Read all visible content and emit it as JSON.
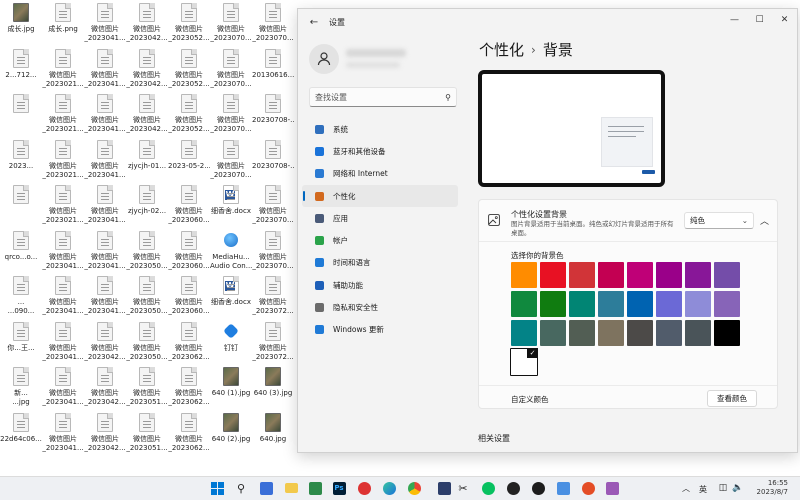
{
  "desktop": {
    "icons": [
      {
        "label": "成长.jpg",
        "label2": "",
        "kind": "photo"
      },
      {
        "label": "成长.png",
        "label2": "",
        "kind": "file"
      },
      {
        "label": "微信图片",
        "label2": "_2023041...",
        "kind": "file"
      },
      {
        "label": "微信图片",
        "label2": "_2023042...",
        "kind": "file"
      },
      {
        "label": "微信图片",
        "label2": "_2023052...",
        "kind": "file"
      },
      {
        "label": "微信图片",
        "label2": "_2023070...",
        "kind": "file"
      },
      {
        "label": "微信图片",
        "label2": "_2023070...",
        "kind": "file"
      },
      {
        "label": "2...712...",
        "label2": "",
        "kind": "file"
      },
      {
        "label": "微信图片",
        "label2": "_2023021...",
        "kind": "file"
      },
      {
        "label": "微信图片",
        "label2": "_2023041...",
        "kind": "file"
      },
      {
        "label": "微信图片",
        "label2": "_2023042...",
        "kind": "file"
      },
      {
        "label": "微信图片",
        "label2": "_2023052...",
        "kind": "file"
      },
      {
        "label": "微信图片",
        "label2": "_2023070...",
        "kind": "file"
      },
      {
        "label": "20130616...",
        "label2": "",
        "kind": "file"
      },
      {
        "label": "",
        "label2": "",
        "kind": "file"
      },
      {
        "label": "微信图片",
        "label2": "_2023021...",
        "kind": "file"
      },
      {
        "label": "微信图片",
        "label2": "_2023041...",
        "kind": "file"
      },
      {
        "label": "微信图片",
        "label2": "_2023042...",
        "kind": "file"
      },
      {
        "label": "微信图片",
        "label2": "_2023052...",
        "kind": "file"
      },
      {
        "label": "微信图片",
        "label2": "_2023070...",
        "kind": "file"
      },
      {
        "label": "20230708-...",
        "label2": "",
        "kind": "file"
      },
      {
        "label": "2023...",
        "label2": "",
        "kind": "file"
      },
      {
        "label": "微信图片",
        "label2": "_2023021...",
        "kind": "file"
      },
      {
        "label": "微信图片",
        "label2": "_2023041...",
        "kind": "file"
      },
      {
        "label": "zjycjh-01...",
        "label2": "",
        "kind": "file"
      },
      {
        "label": "2023-05-2...",
        "label2": "",
        "kind": "file"
      },
      {
        "label": "微信图片",
        "label2": "_2023070...",
        "kind": "file"
      },
      {
        "label": "20230708-...",
        "label2": "",
        "kind": "file"
      },
      {
        "label": "",
        "label2": "",
        "kind": "file"
      },
      {
        "label": "微信图片",
        "label2": "_2023021...",
        "kind": "file"
      },
      {
        "label": "微信图片",
        "label2": "_2023041...",
        "kind": "file"
      },
      {
        "label": "zjycjh-02...",
        "label2": "",
        "kind": "file"
      },
      {
        "label": "微信图片",
        "label2": "_2023060...",
        "kind": "file"
      },
      {
        "label": "细香舍.docx",
        "label2": "",
        "kind": "doc"
      },
      {
        "label": "微信图片",
        "label2": "_2023070...",
        "kind": "file"
      },
      {
        "label": "qrco...o...",
        "label2": "",
        "kind": "file"
      },
      {
        "label": "微信图片",
        "label2": "_2023041...",
        "kind": "file"
      },
      {
        "label": "微信图片",
        "label2": "_2023041...",
        "kind": "file"
      },
      {
        "label": "微信图片",
        "label2": "_2023050...",
        "kind": "file"
      },
      {
        "label": "微信图片",
        "label2": "_2023060...",
        "kind": "file"
      },
      {
        "label": "MediaHu...",
        "label2": "Audio Con...",
        "kind": "globe"
      },
      {
        "label": "微信图片",
        "label2": "_2023070...",
        "kind": "file"
      },
      {
        "label": "...",
        "label2": "...090...",
        "kind": "file"
      },
      {
        "label": "微信图片",
        "label2": "_2023041...",
        "kind": "file"
      },
      {
        "label": "微信图片",
        "label2": "_2023041...",
        "kind": "file"
      },
      {
        "label": "微信图片",
        "label2": "_2023050...",
        "kind": "file"
      },
      {
        "label": "微信图片",
        "label2": "_2023060...",
        "kind": "file"
      },
      {
        "label": "细香舍.docx",
        "label2": "",
        "kind": "doc"
      },
      {
        "label": "微信图片",
        "label2": "_2023072...",
        "kind": "file"
      },
      {
        "label": "你...王...",
        "label2": "",
        "kind": "file"
      },
      {
        "label": "微信图片",
        "label2": "_2023041...",
        "kind": "file"
      },
      {
        "label": "微信图片",
        "label2": "_2023042...",
        "kind": "file"
      },
      {
        "label": "微信图片",
        "label2": "_2023050...",
        "kind": "file"
      },
      {
        "label": "微信图片",
        "label2": "_2023062...",
        "kind": "file"
      },
      {
        "label": "钉钉",
        "label2": "",
        "kind": "blue"
      },
      {
        "label": "微信图片",
        "label2": "_2023072...",
        "kind": "file"
      },
      {
        "label": "新...",
        "label2": "...jpg",
        "kind": "file"
      },
      {
        "label": "微信图片",
        "label2": "_2023041...",
        "kind": "file"
      },
      {
        "label": "微信图片",
        "label2": "_2023042...",
        "kind": "file"
      },
      {
        "label": "微信图片",
        "label2": "_2023051...",
        "kind": "file"
      },
      {
        "label": "微信图片",
        "label2": "_2023062...",
        "kind": "file"
      },
      {
        "label": "640 (1).jpg",
        "label2": "",
        "kind": "photo"
      },
      {
        "label": "640 (3).jpg",
        "label2": "",
        "kind": "photo"
      },
      {
        "label": "22d64c06...",
        "label2": "",
        "kind": "file"
      },
      {
        "label": "微信图片",
        "label2": "_2023041...",
        "kind": "file"
      },
      {
        "label": "微信图片",
        "label2": "_2023042...",
        "kind": "file"
      },
      {
        "label": "微信图片",
        "label2": "_2023051...",
        "kind": "file"
      },
      {
        "label": "微信图片",
        "label2": "_2023062...",
        "kind": "file"
      },
      {
        "label": "640 (2).jpg",
        "label2": "",
        "kind": "photo"
      },
      {
        "label": "640.jpg",
        "label2": "",
        "kind": "photo"
      }
    ]
  },
  "window": {
    "title": "设置",
    "search_placeholder": "查找设置",
    "nav": [
      {
        "label": "系统",
        "icon": "monitor-icon",
        "color": "#2f6fbd",
        "active": false
      },
      {
        "label": "蓝牙和其他设备",
        "icon": "bluetooth-icon",
        "color": "#1a73d9",
        "active": false
      },
      {
        "label": "网络和 Internet",
        "icon": "wifi-icon",
        "color": "#2a7ad2",
        "active": false
      },
      {
        "label": "个性化",
        "icon": "brush-icon",
        "color": "#d2691e",
        "active": true
      },
      {
        "label": "应用",
        "icon": "apps-icon",
        "color": "#4a5a78",
        "active": false
      },
      {
        "label": "帐户",
        "icon": "account-icon",
        "color": "#2aa34a",
        "active": false
      },
      {
        "label": "时间和语言",
        "icon": "globe-icon",
        "color": "#1f7ad6",
        "active": false
      },
      {
        "label": "辅助功能",
        "icon": "accessibility-icon",
        "color": "#1d5fb8",
        "active": false
      },
      {
        "label": "隐私和安全性",
        "icon": "shield-icon",
        "color": "#6b6b6b",
        "active": false
      },
      {
        "label": "Windows 更新",
        "icon": "update-icon",
        "color": "#1f7ad6",
        "active": false
      }
    ],
    "breadcrumb": {
      "parent": "个性化",
      "separator": "›",
      "current": "背景"
    },
    "background_panel": {
      "title": "个性化设置背景",
      "description": "图片背景适用于当前桌面。纯色或幻灯片背景适用于所有桌面。",
      "dropdown_value": "纯色",
      "choose_color_label": "选择你的背景色",
      "selected_color": "#ffffff",
      "colors": [
        "#ff8c00",
        "#e81123",
        "#d13438",
        "#c30052",
        "#bf0077",
        "#9a0089",
        "#881798",
        "#744da9",
        "#10893e",
        "#107c10",
        "#018574",
        "#2d7d9a",
        "#0063b1",
        "#6b69d6",
        "#8e8cd8",
        "#8764b8",
        "#038387",
        "#486860",
        "#525e54",
        "#7e735f",
        "#4c4a48",
        "#515c6b",
        "#4a5459",
        "#000000",
        "#ffffff"
      ],
      "custom_color_label": "自定义颜色",
      "view_colors_button": "查看颜色"
    },
    "related_settings_label": "相关设置"
  },
  "taskbar": {
    "items": [
      "start-icon",
      "search-icon",
      "app-icon",
      "folder-icon",
      "app-icon",
      "photoshop-icon",
      "edge-icon",
      "store-icon",
      "chrome-icon",
      "monitor-icon",
      "capcut-icon",
      "wechat-icon",
      "app-icon",
      "app-icon",
      "app-icon",
      "app-icon",
      "app-icon"
    ],
    "ps_label": "Ps",
    "ime_label": "英",
    "time": "16:55",
    "date": "2023/8/7"
  }
}
